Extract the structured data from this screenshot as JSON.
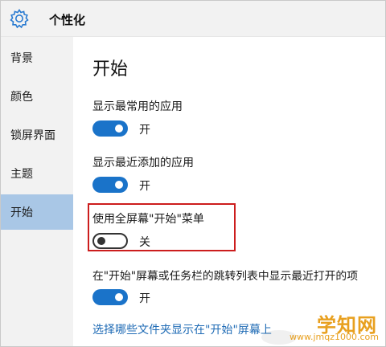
{
  "app": {
    "title": "个性化",
    "icon": "gear-icon"
  },
  "sidebar": {
    "items": [
      {
        "label": "背景"
      },
      {
        "label": "颜色"
      },
      {
        "label": "锁屏界面"
      },
      {
        "label": "主题"
      },
      {
        "label": "开始",
        "active": true
      }
    ]
  },
  "main": {
    "title": "开始",
    "settings": [
      {
        "label": "显示最常用的应用",
        "state": "开",
        "on": true
      },
      {
        "label": "显示最近添加的应用",
        "state": "开",
        "on": true
      },
      {
        "label": "使用全屏幕\"开始\"菜单",
        "state": "关",
        "on": false
      },
      {
        "label": "在\"开始\"屏幕或任务栏的跳转列表中显示最近打开的项",
        "state": "开",
        "on": true
      }
    ],
    "link": "选择哪些文件夹显示在\"开始\"屏幕上"
  },
  "watermark": {
    "main": "学知网",
    "sub": "www.jmqz1000.com"
  },
  "colors": {
    "accent": "#1a73c9",
    "active_bg": "#a9c7e6",
    "highlight": "#cc1d1d",
    "link": "#1f6bb5",
    "watermark": "#e8a01f"
  }
}
